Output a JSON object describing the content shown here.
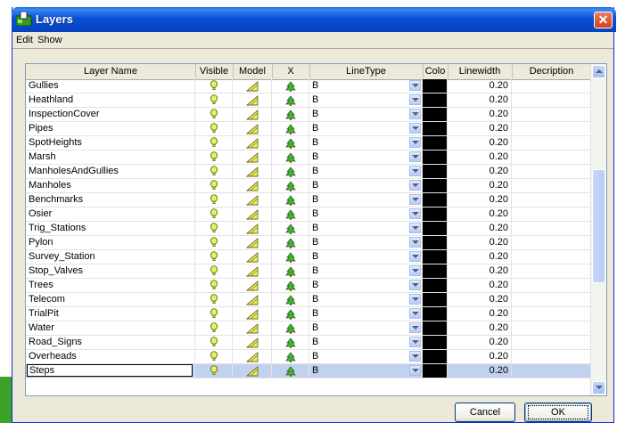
{
  "window": {
    "title": "Layers",
    "close_label": "✕"
  },
  "menu": {
    "items": [
      "Edit",
      "Show"
    ]
  },
  "columns": [
    "Layer Name",
    "Visible",
    "Model",
    "X",
    "LineType",
    "Colo",
    "Linewidth",
    "Decription"
  ],
  "layers": [
    {
      "name": "Gullies",
      "linetype": "B",
      "linewidth": "0.20"
    },
    {
      "name": "Heathland",
      "linetype": "B",
      "linewidth": "0.20"
    },
    {
      "name": "InspectionCover",
      "linetype": "B",
      "linewidth": "0.20"
    },
    {
      "name": "Pipes",
      "linetype": "B",
      "linewidth": "0.20"
    },
    {
      "name": "SpotHeights",
      "linetype": "B",
      "linewidth": "0.20"
    },
    {
      "name": "Marsh",
      "linetype": "B",
      "linewidth": "0.20"
    },
    {
      "name": "ManholesAndGullies",
      "linetype": "B",
      "linewidth": "0.20"
    },
    {
      "name": "Manholes",
      "linetype": "B",
      "linewidth": "0.20"
    },
    {
      "name": "Benchmarks",
      "linetype": "B",
      "linewidth": "0.20"
    },
    {
      "name": "Osier",
      "linetype": "B",
      "linewidth": "0.20"
    },
    {
      "name": "Trig_Stations",
      "linetype": "B",
      "linewidth": "0.20"
    },
    {
      "name": "Pylon",
      "linetype": "B",
      "linewidth": "0.20"
    },
    {
      "name": "Survey_Station",
      "linetype": "B",
      "linewidth": "0.20"
    },
    {
      "name": "Stop_Valves",
      "linetype": "B",
      "linewidth": "0.20"
    },
    {
      "name": "Trees",
      "linetype": "B",
      "linewidth": "0.20"
    },
    {
      "name": "Telecom",
      "linetype": "B",
      "linewidth": "0.20"
    },
    {
      "name": "TrialPit",
      "linetype": "B",
      "linewidth": "0.20"
    },
    {
      "name": "Water",
      "linetype": "B",
      "linewidth": "0.20"
    },
    {
      "name": "Road_Signs",
      "linetype": "B",
      "linewidth": "0.20"
    },
    {
      "name": "Overheads",
      "linetype": "B",
      "linewidth": "0.20"
    },
    {
      "name": "Steps",
      "linetype": "B",
      "linewidth": "0.20",
      "selected": true
    }
  ],
  "colors": {
    "layer_color": "#000000",
    "visible_icon": "#e8f060",
    "model_icon": "#f0f060",
    "x_icon": "#4caf3a",
    "selection": "#c1d2ee"
  },
  "icons": {
    "visible": "lightbulb-icon",
    "model": "triangle-icon",
    "x": "tree-icon"
  },
  "buttons": {
    "cancel": "Cancel",
    "ok": "OK"
  }
}
